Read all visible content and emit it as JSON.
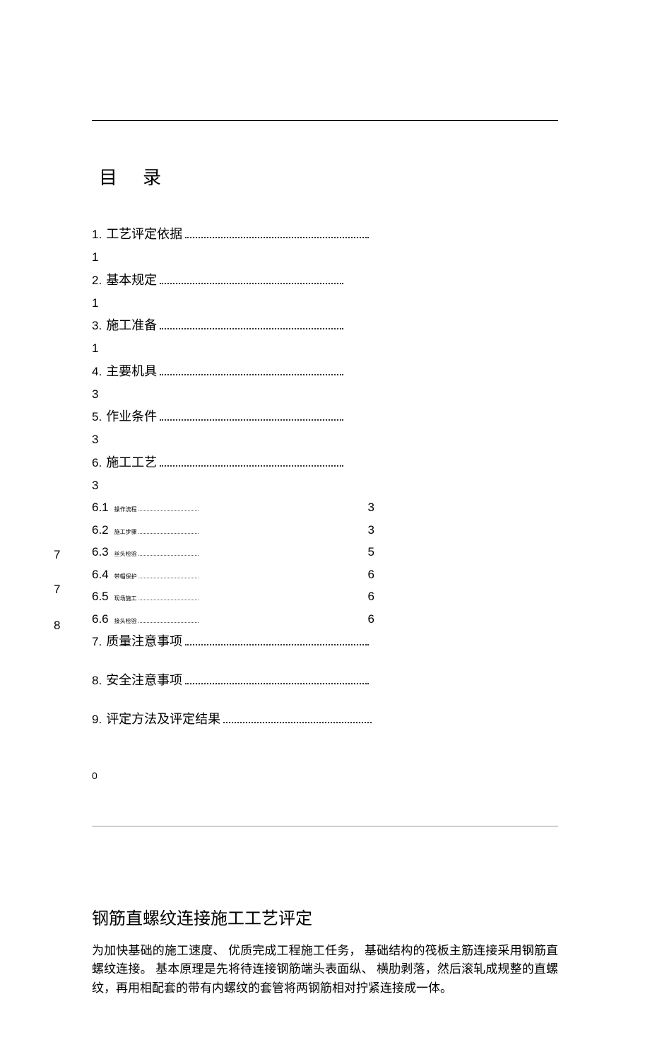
{
  "toc": {
    "title": "目录",
    "items": [
      {
        "num": "1.",
        "label": "工艺评定依据",
        "page": "1"
      },
      {
        "num": "2.",
        "label": "基本规定",
        "page": "1"
      },
      {
        "num": "3.",
        "label": "施工准备",
        "page": "1"
      },
      {
        "num": "4.",
        "label": "主要机具",
        "page": "3"
      },
      {
        "num": "5.",
        "label": "作业条件",
        "page": "3"
      },
      {
        "num": "6.",
        "label": "施工工艺",
        "page": "3"
      }
    ],
    "subitems": [
      {
        "num": "6.1",
        "label": "操作流程",
        "page": "3"
      },
      {
        "num": "6.2",
        "label": "施工步骤",
        "page": "3"
      },
      {
        "num": "6.3",
        "label": "丝头检验",
        "page": "5"
      },
      {
        "num": "6.4",
        "label": "带帽保护",
        "page": "6"
      },
      {
        "num": "6.5",
        "label": "现场施工",
        "page": "6"
      },
      {
        "num": "6.6",
        "label": "接头检验",
        "page": "6"
      }
    ],
    "items_tail": [
      {
        "num": "7.",
        "label": "质量注意事项",
        "page": "7"
      },
      {
        "num": "8.",
        "label": "安全注意事项",
        "page": "7"
      },
      {
        "num": "9.",
        "label": "评定方法及评定结果",
        "page": "8"
      }
    ],
    "footer_num": "0"
  },
  "section2": {
    "title": "钢筋直螺纹连接施工工艺评定",
    "paragraph": "为加快基础的施工速度、 优质完成工程施工任务， 基础结构的筏板主筋连接采用钢筋直螺纹连接。 基本原理是先将待连接钢筋端头表面纵、 横肋剥落，然后滚轧成规整的直螺纹，再用相配套的带有内螺纹的套管将两钢筋相对拧紧连接成一体。"
  }
}
